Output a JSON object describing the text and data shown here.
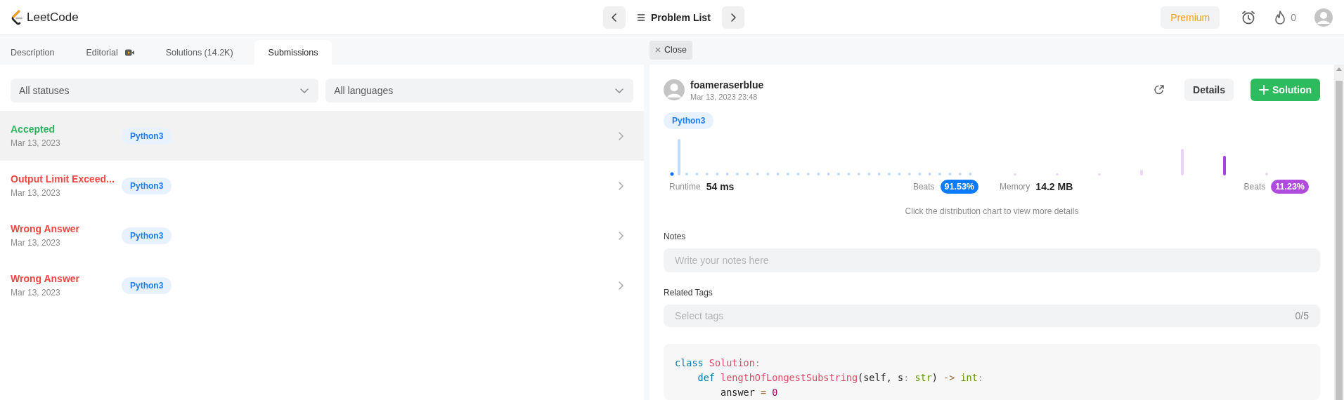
{
  "header": {
    "logo": "LeetCode",
    "problem_list": "Problem List",
    "premium": "Premium",
    "streak": "0"
  },
  "tabs": [
    {
      "label": "Description",
      "selected": false,
      "kind": "text"
    },
    {
      "label": "Editorial",
      "selected": false,
      "kind": "video"
    },
    {
      "label": "Solutions (14.2K)",
      "selected": false,
      "kind": "text"
    },
    {
      "label": "Submissions",
      "selected": true,
      "kind": "text"
    }
  ],
  "filters": [
    {
      "value": "All statuses"
    },
    {
      "value": "All languages"
    }
  ],
  "submissions": [
    {
      "status": "Accepted",
      "kind": "accepted",
      "date": "Mar 13, 2023",
      "language": "Python3",
      "selected": true
    },
    {
      "status": "Output Limit Exceed...",
      "kind": "error",
      "date": "Mar 13, 2023",
      "language": "Python3",
      "selected": false
    },
    {
      "status": "Wrong Answer",
      "kind": "error",
      "date": "Mar 13, 2023",
      "language": "Python3",
      "selected": false
    },
    {
      "status": "Wrong Answer",
      "kind": "error",
      "date": "Mar 13, 2023",
      "language": "Python3",
      "selected": false
    }
  ],
  "detail": {
    "close": "Close",
    "user": "foameraserblue",
    "time": "Mar 13, 2023 23:48",
    "details": "Details",
    "solution": "Solution",
    "language": "Python3",
    "stats": [
      {
        "label": "Runtime",
        "value": "54 ms",
        "beats_label": "Beats",
        "beats": "91.53%",
        "kind": "runtime"
      },
      {
        "label": "Memory",
        "value": "14.2 MB",
        "beats_label": "Beats",
        "beats": "11.23%",
        "kind": "memory"
      }
    ],
    "hint": "Click the distribution chart to view more details",
    "notes_label": "Notes",
    "notes_placeholder": "Write your notes here",
    "tags_label": "Related Tags",
    "tags_placeholder": "Select tags",
    "tags_count": "0/5",
    "code": [
      [
        {
          "text": "class",
          "kind": "keyword"
        },
        {
          "text": " Solution",
          "kind": "name"
        },
        {
          "text": ":",
          "kind": "punct"
        }
      ],
      [
        {
          "text": "    def",
          "kind": "keyword"
        },
        {
          "text": " lengthOfLongestSubstring",
          "kind": "name"
        },
        {
          "text": "(self, s",
          "kind": "plain"
        },
        {
          "text": ":",
          "kind": "punct"
        },
        {
          "text": " str",
          "kind": "type"
        },
        {
          "text": ") ",
          "kind": "plain"
        },
        {
          "text": "->",
          "kind": "operator"
        },
        {
          "text": " int",
          "kind": "type"
        },
        {
          "text": ":",
          "kind": "punct"
        }
      ],
      [
        {
          "text": "        answer ",
          "kind": "plain"
        },
        {
          "text": "=",
          "kind": "operator"
        },
        {
          "text": " 0",
          "kind": "number"
        }
      ]
    ]
  }
}
